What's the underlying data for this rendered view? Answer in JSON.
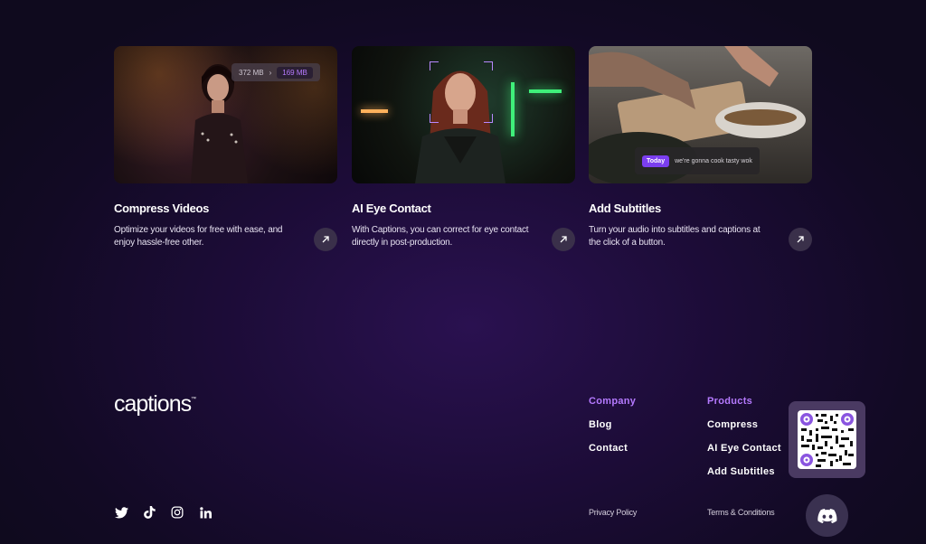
{
  "cards": [
    {
      "title": "Compress Videos",
      "description": "Optimize your videos for free with ease, and enjoy hassle-free other.",
      "size_before": "372 MB",
      "size_arrow": "›",
      "size_after": "169 MB"
    },
    {
      "title": "AI Eye Contact",
      "description": "With Captions, you can correct for eye contact directly in post-production."
    },
    {
      "title": "Add Subtitles",
      "description": "Turn your audio into subtitles and captions at the click of a button.",
      "subtitle_badge": "Today",
      "subtitle_text": "we're gonna cook tasty wok"
    }
  ],
  "footer": {
    "logo": "captions",
    "logo_tm": "™",
    "company": {
      "heading": "Company",
      "links": [
        "Blog",
        "Contact"
      ]
    },
    "products": {
      "heading": "Products",
      "links": [
        "Compress",
        "AI Eye Contact",
        "Add Subtitles"
      ]
    },
    "privacy": "Privacy Policy",
    "terms": "Terms & Conditions",
    "social_icons": [
      "twitter-icon",
      "tiktok-icon",
      "instagram-icon",
      "linkedin-icon"
    ]
  },
  "colors": {
    "accent": "#b57aff",
    "badge": "#7b3ef0",
    "background": "#1c0c37"
  }
}
